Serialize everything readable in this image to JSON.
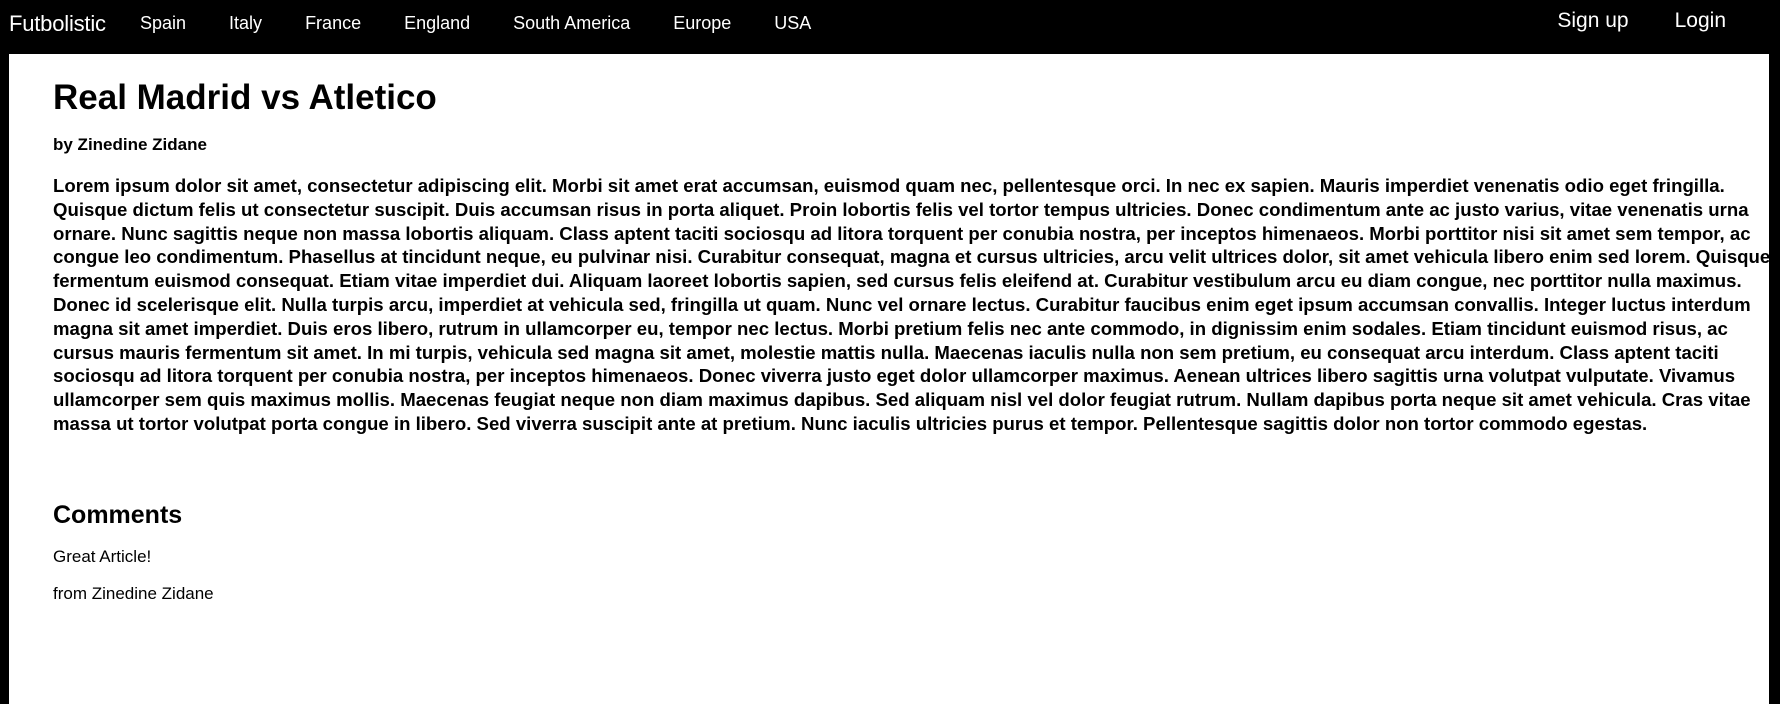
{
  "nav": {
    "brand": "Futbolistic",
    "links": [
      "Spain",
      "Italy",
      "France",
      "England",
      "South America",
      "Europe",
      "USA"
    ],
    "signup": "Sign up",
    "login": "Login"
  },
  "article": {
    "title": "Real Madrid vs Atletico",
    "byline": "by Zinedine Zidane",
    "body": "Lorem ipsum dolor sit amet, consectetur adipiscing elit. Morbi sit amet erat accumsan, euismod quam nec, pellentesque orci. In nec ex sapien. Mauris imperdiet venenatis odio eget fringilla. Quisque dictum felis ut consectetur suscipit. Duis accumsan risus in porta aliquet. Proin lobortis felis vel tortor tempus ultricies. Donec condimentum ante ac justo varius, vitae venenatis urna ornare. Nunc sagittis neque non massa lobortis aliquam. Class aptent taciti sociosqu ad litora torquent per conubia nostra, per inceptos himenaeos. Morbi porttitor nisi sit amet sem tempor, ac congue leo condimentum. Phasellus at tincidunt neque, eu pulvinar nisi. Curabitur consequat, magna et cursus ultricies, arcu velit ultrices dolor, sit amet vehicula libero enim sed lorem. Quisque fermentum euismod consequat. Etiam vitae imperdiet dui. Aliquam laoreet lobortis sapien, sed cursus felis eleifend at. Curabitur vestibulum arcu eu diam congue, nec porttitor nulla maximus. Donec id scelerisque elit. Nulla turpis arcu, imperdiet at vehicula sed, fringilla ut quam. Nunc vel ornare lectus. Curabitur faucibus enim eget ipsum accumsan convallis. Integer luctus interdum magna sit amet imperdiet. Duis eros libero, rutrum in ullamcorper eu, tempor nec lectus. Morbi pretium felis nec ante commodo, in dignissim enim sodales. Etiam tincidunt euismod risus, ac cursus mauris fermentum sit amet. In mi turpis, vehicula sed magna sit amet, molestie mattis nulla. Maecenas iaculis nulla non sem pretium, eu consequat arcu interdum. Class aptent taciti sociosqu ad litora torquent per conubia nostra, per inceptos himenaeos. Donec viverra justo eget dolor ullamcorper maximus. Aenean ultrices libero sagittis urna volutpat vulputate. Vivamus ullamcorper sem quis maximus mollis. Maecenas feugiat neque non diam maximus dapibus. Sed aliquam nisl vel dolor feugiat rutrum. Nullam dapibus porta neque sit amet vehicula. Cras vitae massa ut tortor volutpat porta congue in libero. Sed viverra suscipit ante at pretium. Nunc iaculis ultricies purus et tempor. Pellentesque sagittis dolor non tortor commodo egestas."
  },
  "comments": {
    "heading": "Comments",
    "items": [
      {
        "text": "Great Article!",
        "author": "from Zinedine Zidane"
      }
    ]
  },
  "colors": {
    "navbar_bg": "#000000",
    "page_bg": "#ffffff",
    "text": "#000000"
  }
}
